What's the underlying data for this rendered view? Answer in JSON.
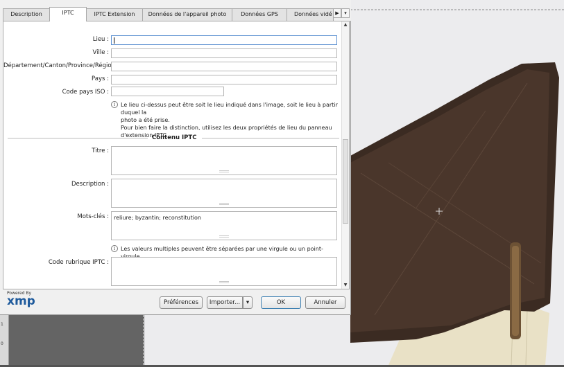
{
  "tabs": [
    {
      "label": "Description"
    },
    {
      "label": "IPTC"
    },
    {
      "label": "IPTC Extension"
    },
    {
      "label": "Données de l'appareil photo"
    },
    {
      "label": "Données GPS"
    },
    {
      "label": "Données vidé"
    }
  ],
  "tab_nav": {
    "next": "▶",
    "menu": "▾"
  },
  "fields": {
    "lieu": {
      "label": "Lieu :",
      "value": ""
    },
    "ville": {
      "label": "Ville :",
      "value": ""
    },
    "departement": {
      "label": "Département/Canton/Province/Région :",
      "value": ""
    },
    "pays": {
      "label": "Pays :",
      "value": ""
    },
    "code_pays": {
      "label": "Code pays ISO :",
      "value": ""
    }
  },
  "location_note": {
    "line1": "Le lieu ci-dessus peut être soit le lieu indiqué dans l'image, soit le lieu à partir duquel la",
    "line2": "photo a été prise.",
    "line3": "Pour bien faire la distinction, utilisez les deux propriétés de lieu du panneau",
    "line4": "d'extension IPTC"
  },
  "section": {
    "title": "Contenu IPTC"
  },
  "content_fields": {
    "titre": {
      "label": "Titre :",
      "value": ""
    },
    "description": {
      "label": "Description :",
      "value": ""
    },
    "mots_cles": {
      "label": "Mots-clés :",
      "value": "reliure; byzantin; reconstitution"
    },
    "code_rubrique": {
      "label": "Code rubrique IPTC :",
      "value": ""
    }
  },
  "keywords_note": "Les valeurs multiples peuvent être séparées par une virgule ou un point-virgule",
  "footer": {
    "powered_by": "Powered By",
    "logo": "xmp",
    "preferences": "Préférences",
    "importer": "Importer...",
    "importer_arrow": "▾",
    "ok": "OK",
    "annuler": "Annuler"
  },
  "ruler": {
    "mark1": "1",
    "mark2": "0"
  },
  "icons": {
    "info": "info-circle-icon",
    "scroll_up": "▲",
    "scroll_down": "▼"
  }
}
